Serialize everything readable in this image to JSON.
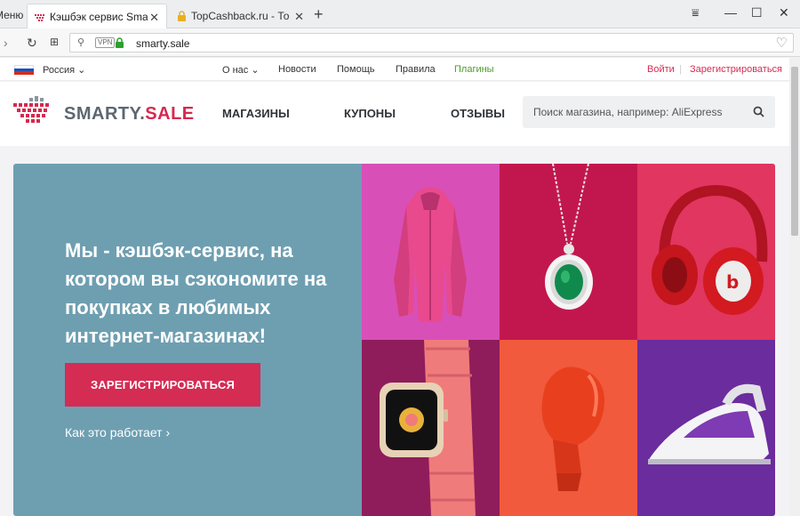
{
  "browser": {
    "menu_label": "Меню",
    "tabs": [
      {
        "title": "Кэшбэк сервис Smarty.Sale",
        "active": true
      },
      {
        "title": "TopCashback.ru - Топ лучших",
        "active": false
      }
    ],
    "new_tab": "+",
    "url": "smarty.sale",
    "vpn": "VPN"
  },
  "topbar": {
    "region": "Россия",
    "links": [
      "О нас",
      "Новости",
      "Помощь",
      "Правила",
      "Плагины"
    ],
    "login": "Войти",
    "register": "Зарегистрироваться"
  },
  "header": {
    "logo_main": "SMARTY.",
    "logo_accent": "SALE",
    "nav": [
      "МАГАЗИНЫ",
      "КУПОНЫ",
      "ОТЗЫВЫ"
    ],
    "search_placeholder": "Поиск магазина, например: AliExpress"
  },
  "hero": {
    "headline": "Мы - кэшбэк-сервис, на котором вы сэкономите на покупках в любимых интернет-магазинах!",
    "cta": "ЗАРЕГИСТРИРОВАТЬСЯ",
    "how_it_works": "Как это работает ›",
    "tiles": [
      {
        "name": "jacket",
        "bg": "#d94fb8"
      },
      {
        "name": "pendant",
        "bg": "#c2174e"
      },
      {
        "name": "headphones",
        "bg": "#e0365f"
      },
      {
        "name": "watch",
        "bg": "#8f1d5b"
      },
      {
        "name": "boxing-glove",
        "bg": "#f15a3c"
      },
      {
        "name": "iron",
        "bg": "#6b2c9e"
      }
    ]
  },
  "colors": {
    "accent": "#d52c54",
    "hero_bg": "#6e9fb1",
    "plugins_link": "#4c9a2a"
  }
}
